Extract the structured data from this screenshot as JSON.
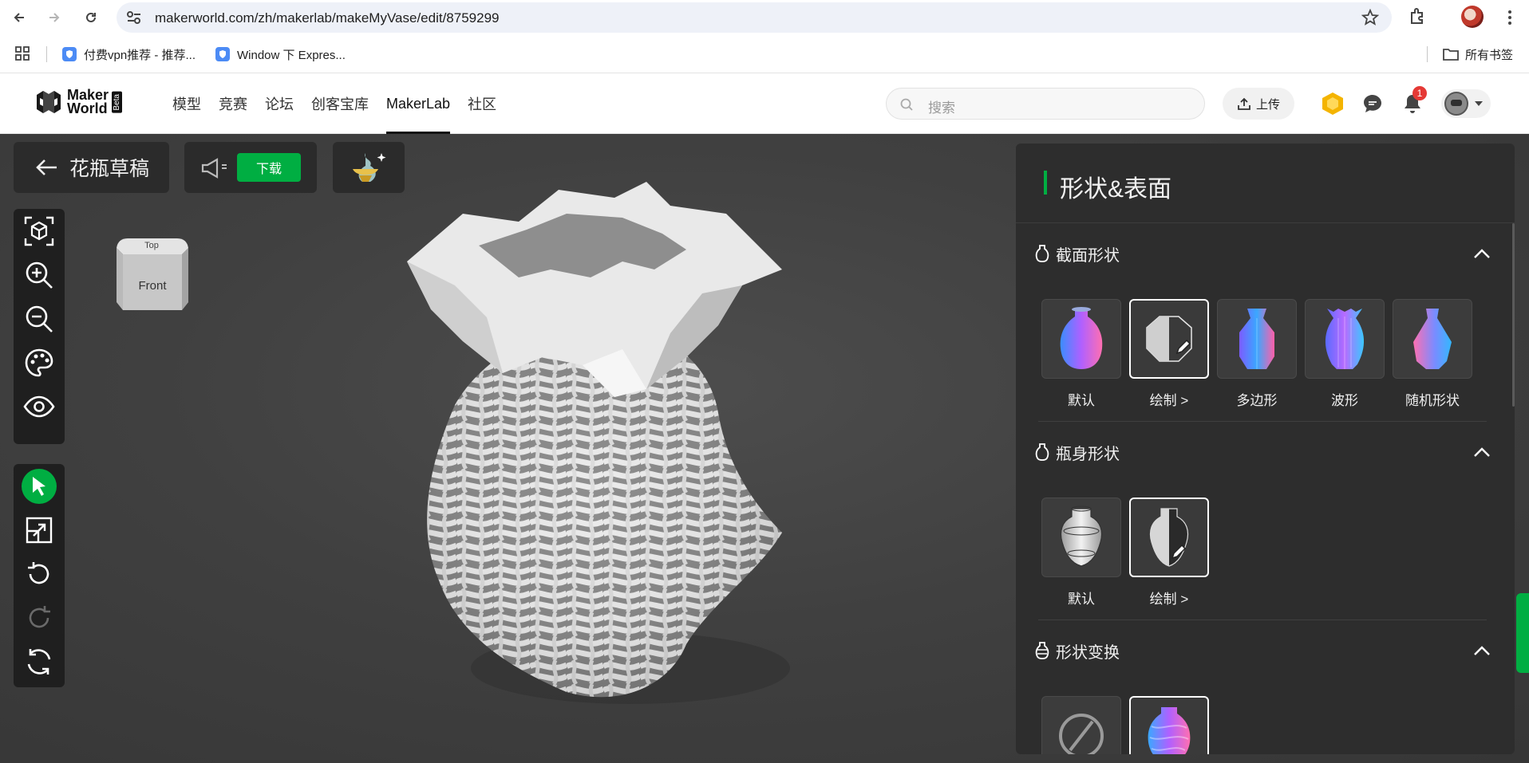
{
  "browser": {
    "url": "makerworld.com/zh/makerlab/makeMyVase/edit/8759299",
    "bookmarks": [
      {
        "label": "付费vpn推荐 - 推荐..."
      },
      {
        "label": "Window 下 Expres..."
      }
    ],
    "all_bookmarks_label": "所有书签"
  },
  "site": {
    "logo_text_1": "Maker",
    "logo_text_2": "World",
    "logo_beta": "Beta",
    "nav": [
      {
        "label": "模型"
      },
      {
        "label": "竞赛"
      },
      {
        "label": "论坛"
      },
      {
        "label": "创客宝库"
      },
      {
        "label": "MakerLab"
      },
      {
        "label": "社区"
      }
    ],
    "active_nav": "MakerLab",
    "search_placeholder": "搜索",
    "upload_label": "上传",
    "notification_count": "1"
  },
  "editor": {
    "title": "花瓶草稿",
    "download_label": "下载",
    "view_cube": {
      "top": "Top",
      "front": "Front"
    }
  },
  "panel": {
    "title": "形状&表面",
    "sections": [
      {
        "title": "截面形状",
        "options": [
          {
            "label": "默认",
            "selected": false
          },
          {
            "label": "绘制 >",
            "selected": true
          },
          {
            "label": "多边形",
            "selected": false
          },
          {
            "label": "波形",
            "selected": false
          },
          {
            "label": "随机形状",
            "selected": false
          }
        ]
      },
      {
        "title": "瓶身形状",
        "options": [
          {
            "label": "默认",
            "selected": false
          },
          {
            "label": "绘制 >",
            "selected": true
          }
        ]
      },
      {
        "title": "形状变换",
        "options": [
          {
            "label": "",
            "selected": false
          },
          {
            "label": "",
            "selected": true
          }
        ]
      }
    ]
  },
  "colors": {
    "accent": "#00ae42",
    "panel_bg": "#2d2d2d",
    "toolbar_bg": "#1f1f1f"
  }
}
